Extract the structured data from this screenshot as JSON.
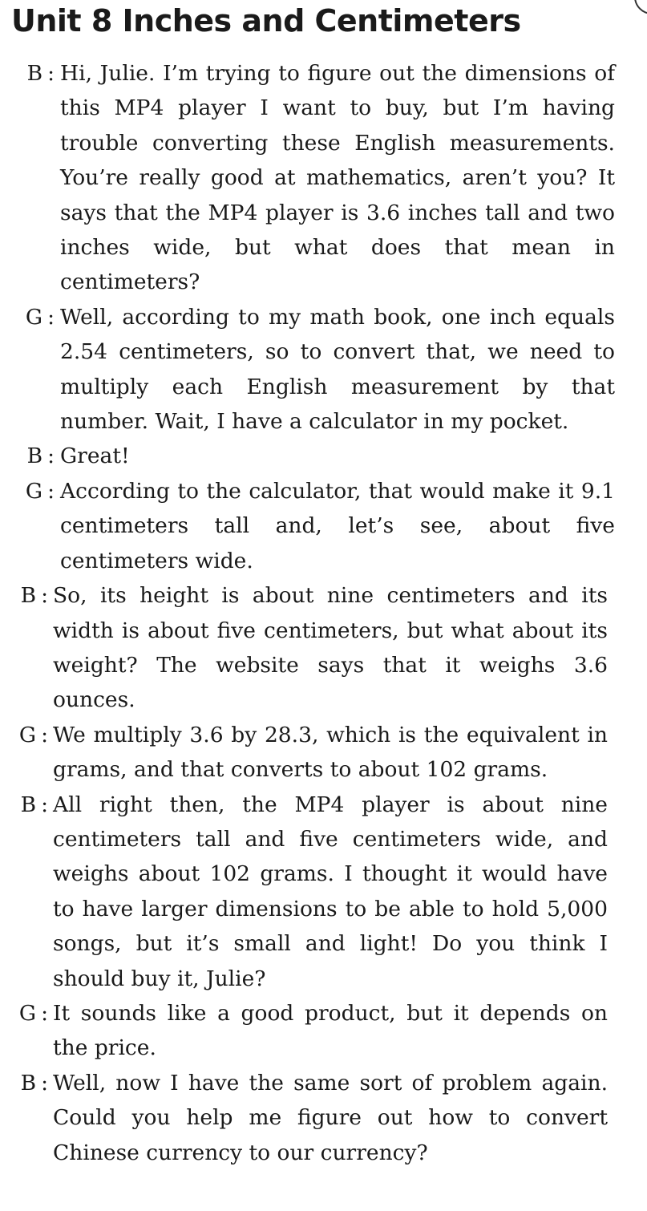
{
  "title": "Unit 8  Inches and Centimeters",
  "dialogue": [
    {
      "speaker": "B",
      "text": "Hi, Julie. I’m trying to figure out the dimensions of this MP4 player I want to buy, but I’m having trouble converting these English measurements. You’re really good at mathematics, aren’t you? It says that the MP4 player is 3.6 inches tall and two inches wide, but what does that mean in centimeters?"
    },
    {
      "speaker": "G",
      "text": "Well, according to my math book, one inch equals 2.54 centimeters, so to convert that, we need to multiply each English measurement by that number. Wait, I have a calculator in my pocket."
    },
    {
      "speaker": "B",
      "text": "Great!"
    },
    {
      "speaker": "G",
      "text": "According to the calculator, that would make it 9.1 centimeters tall and, let’s see, about five centimeters wide."
    },
    {
      "speaker": "B",
      "text": "So, its height is about nine centimeters and its width is about five centimeters, but what about its weight? The website says that it weighs 3.6 ounces."
    },
    {
      "speaker": "G",
      "text": "We multiply 3.6 by 28.3, which is the equivalent in grams, and that converts to about 102 grams."
    },
    {
      "speaker": "B",
      "text": "All right then, the MP4 player is about nine centimeters tall and five centimeters wide, and weighs about 102 grams. I thought it would have to have larger dimensions to be able to hold 5,000 songs, but it’s small and light! Do you think I should buy it, Julie?"
    },
    {
      "speaker": "G",
      "text": "It sounds like a good product, but it depends on the price."
    },
    {
      "speaker": "B",
      "text": "Well, now I have the same sort of problem again. Could you help me figure out how to convert Chinese currency to our currency?"
    }
  ]
}
